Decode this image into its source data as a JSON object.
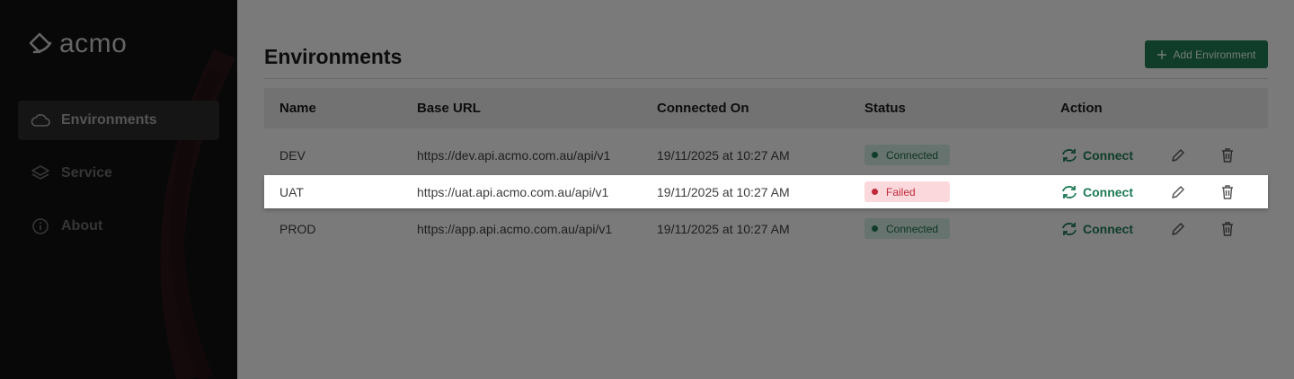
{
  "app": {
    "logo_text": "acmo"
  },
  "sidebar": {
    "items": [
      {
        "label": "Environments",
        "icon": "cloud-icon",
        "active": true
      },
      {
        "label": "Service",
        "icon": "layers-icon",
        "active": false
      },
      {
        "label": "About",
        "icon": "info-icon",
        "active": false
      }
    ]
  },
  "page": {
    "title": "Environments",
    "add_button_label": "Add Environment"
  },
  "table": {
    "headers": {
      "name": "Name",
      "base_url": "Base URL",
      "connected_on": "Connected On",
      "status": "Status",
      "action": "Action"
    },
    "rows": [
      {
        "name": "DEV",
        "base_url": "https://dev.api.acmo.com.au/api/v1",
        "connected_on": "19/11/2025 at 10:27 AM",
        "status": "Connected",
        "action": "Connect"
      },
      {
        "name": "UAT",
        "base_url": "https://uat.api.acmo.com.au/api/v1",
        "connected_on": "19/11/2025 at 10:27 AM",
        "status": "Failed",
        "action": "Connect"
      },
      {
        "name": "PROD",
        "base_url": "https://app.api.acmo.com.au/api/v1",
        "connected_on": "19/11/2025 at 10:27 AM",
        "status": "Connected",
        "action": "Connect"
      }
    ]
  },
  "colors": {
    "accent": "#1e7a55",
    "danger": "#c0293a",
    "sidebar_bg": "#111111"
  }
}
